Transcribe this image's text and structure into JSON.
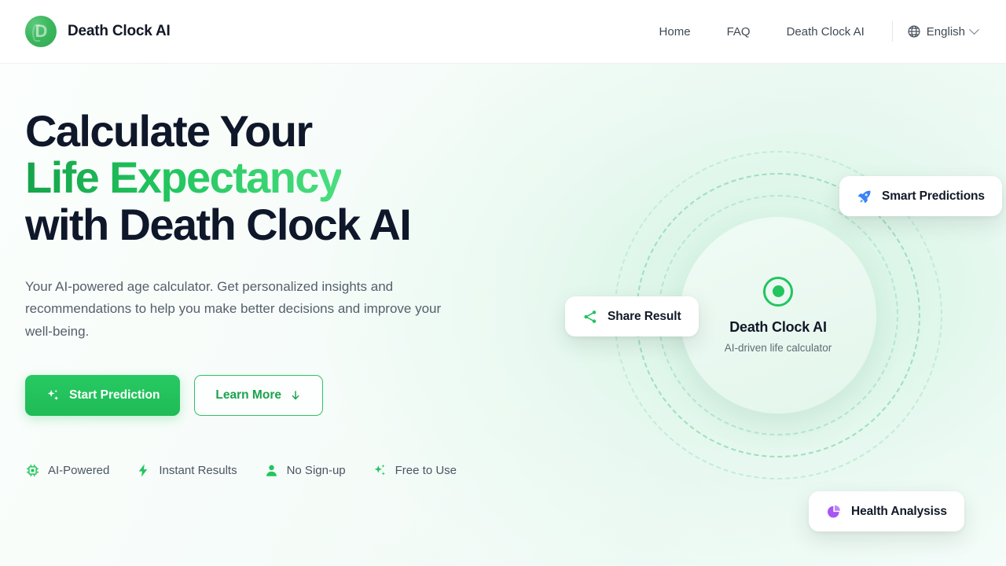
{
  "header": {
    "brand": {
      "name": "Death Clock AI",
      "logo_icon": "death-clock-logo",
      "logo_glyph": "D"
    },
    "nav": [
      {
        "label": "Home"
      },
      {
        "label": "FAQ"
      },
      {
        "label": "Death Clock AI"
      }
    ],
    "language": {
      "icon": "globe-icon",
      "label": "English",
      "chevron": "chevron-down-icon"
    }
  },
  "hero": {
    "headline_line1": "Calculate Your",
    "headline_accent": "Life Expectancy",
    "headline_line3": "with Death Clock AI",
    "subhead": "Your AI-powered age calculator. Get personalized insights and recommendations to help you make better decisions and improve your well-being.",
    "cta": {
      "primary": {
        "label": "Start Prediction",
        "icon": "sparkles-icon"
      },
      "secondary": {
        "label": "Learn More",
        "icon": "arrow-down-icon"
      }
    },
    "features": [
      {
        "label": "AI-Powered",
        "icon": "cpu-chip-icon"
      },
      {
        "label": "Instant Results",
        "icon": "lightning-bolt-icon"
      },
      {
        "label": "No Sign-up",
        "icon": "person-icon"
      },
      {
        "label": "Free to Use",
        "icon": "sparkles-icon"
      }
    ]
  },
  "visual": {
    "core": {
      "icon": "target-dot-icon",
      "title": "Death Clock AI",
      "subtitle": "AI-driven life calculator"
    },
    "cards": [
      {
        "label": "Smart Predictions",
        "icon": "rocket-icon",
        "icon_color": "#3b82f6"
      },
      {
        "label": "Share Result",
        "icon": "share-icon",
        "icon_color": "#22c55e"
      },
      {
        "label": "Health Analysiss",
        "icon": "pie-chart-icon",
        "icon_color": "#a855f7"
      }
    ],
    "rings": 3
  },
  "colors": {
    "accent_green": "#22c55e",
    "accent_green_dark": "#15a34a",
    "text_dark": "#0f172a",
    "text_muted": "#55606b",
    "rocket_blue": "#3b82f6",
    "health_purple": "#a855f7",
    "ring_green": "#a8e4c6"
  }
}
